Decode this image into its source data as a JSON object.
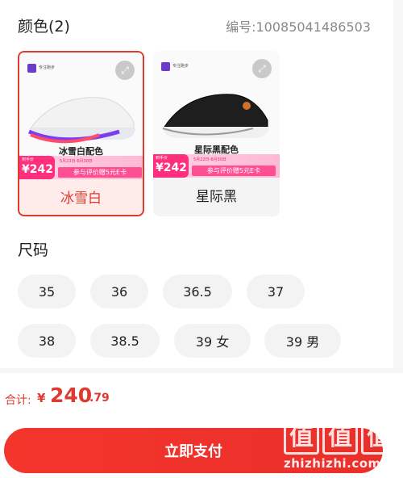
{
  "color_section": {
    "title": "颜色(2)",
    "sku_code": "编号:10085041486503"
  },
  "color_options": [
    {
      "label": "冰雪白",
      "promo_name": "冰雪白配色",
      "price": "242",
      "price_tag": "到手价",
      "date_text": "5月22日-6月30日",
      "feedback_text": "参与评价赠5元E卡",
      "logo_text": "专注跑步",
      "selected": true,
      "shoe_upper_color": "#f2f2f2",
      "shoe_sole_color": "#e8e8f0",
      "shoe_accent_color": "#7a3df0"
    },
    {
      "label": "星际黑",
      "promo_name": "星际黑配色",
      "price": "242",
      "price_tag": "到手价",
      "date_text": "5月22日-6月30日",
      "feedback_text": "参与评价赠5元E卡",
      "logo_text": "专注跑步",
      "selected": false,
      "shoe_upper_color": "#1e1e1e",
      "shoe_sole_color": "#f0f0f0",
      "shoe_accent_color": "#d0722a"
    }
  ],
  "size_section": {
    "title": "尺码",
    "sizes": [
      "35",
      "36",
      "36.5",
      "37",
      "38",
      "38.5",
      "39 女",
      "39 男"
    ]
  },
  "footer": {
    "total_label": "合计:",
    "currency_symbol": "¥",
    "total_integer": "240",
    "total_decimal": ".79",
    "pay_button_label": "立即支付"
  },
  "watermark": {
    "glyphs": [
      "值",
      "值",
      "值"
    ],
    "domain": "zhizhizhi.com"
  },
  "colors": {
    "accent": "#e03a2e",
    "selected_bg": "#fdecea",
    "chip_bg": "#f3f3f3",
    "pay_button": "#f4352c"
  }
}
